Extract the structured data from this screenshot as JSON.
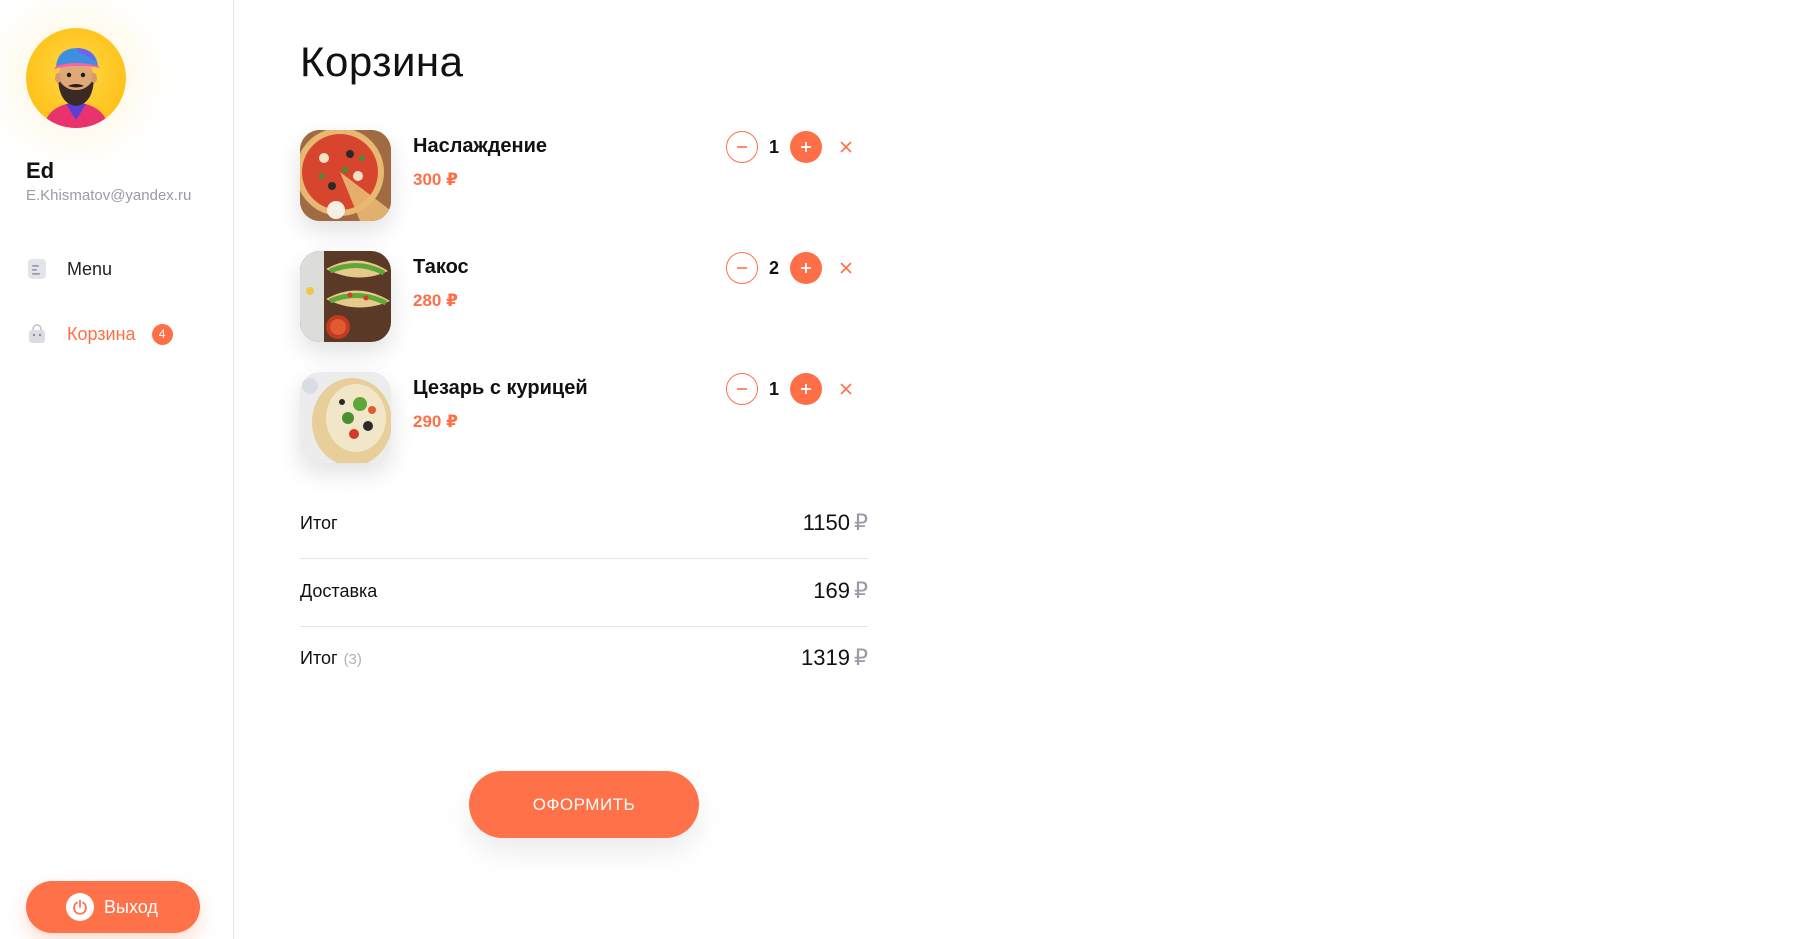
{
  "colors": {
    "accent": "#ff6f47",
    "text": "#111111",
    "muted": "#9a9aa8",
    "divider": "#e4e4e4"
  },
  "user": {
    "name": "Ed",
    "email": "E.Khismatov@yandex.ru",
    "avatar_icon": "bearded-man-avatar"
  },
  "sidebar": {
    "items": [
      {
        "label": "Menu",
        "icon": "document-icon",
        "active": false
      },
      {
        "label": "Корзина",
        "icon": "shopping-bag-icon",
        "active": true,
        "badge": "4"
      }
    ],
    "logout": {
      "label": "Выход",
      "icon": "power-icon"
    }
  },
  "cart": {
    "title": "Корзина",
    "items": [
      {
        "name": "Наслаждение",
        "price": "300 ₽",
        "quantity": "1",
        "image": "pizza-image"
      },
      {
        "name": "Такос",
        "price": "280 ₽",
        "quantity": "2",
        "image": "tacos-image"
      },
      {
        "name": "Цезарь с курицей",
        "price": "290 ₽",
        "quantity": "1",
        "image": "caesar-wrap-image"
      }
    ],
    "summary": {
      "subtotal_label": "Итог",
      "subtotal_value": "1150",
      "delivery_label": "Доставка",
      "delivery_value": "169",
      "total_label": "Итог",
      "total_count": "(3)",
      "total_value": "1319",
      "currency": "₽"
    },
    "checkout_label": "ОФОРМИТЬ"
  }
}
